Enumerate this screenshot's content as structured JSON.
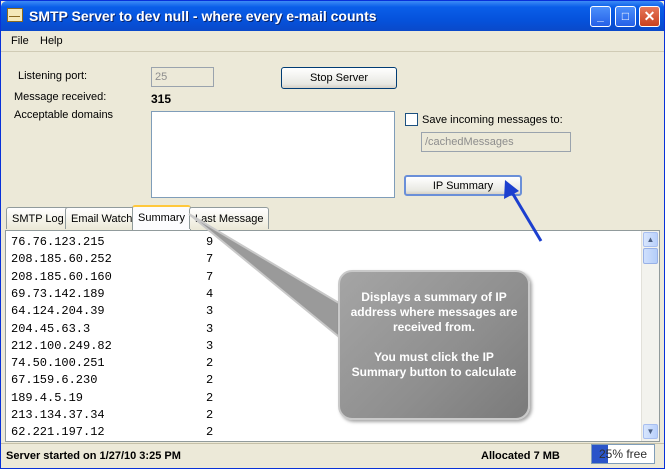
{
  "window": {
    "title": "SMTP Server to dev null - where every e-mail counts"
  },
  "title_buttons": {
    "minimize": "_",
    "maximize": "□",
    "close": "✕"
  },
  "menu": {
    "items": [
      "File",
      "Help"
    ]
  },
  "form": {
    "listening_port_label": "Listening port:",
    "listening_port_value": "25",
    "message_received_label": "Message received:",
    "message_received_value": "315",
    "acceptable_domains_label": "Acceptable domains",
    "stop_server_label": "Stop Server",
    "save_messages_label": "Save incoming messages to:",
    "save_path_value": "/cachedMessages",
    "ip_summary_label": "IP Summary"
  },
  "tabs": [
    "SMTP Log",
    "Email Watch",
    "Summary",
    "Last Message"
  ],
  "active_tab": "Summary",
  "summary_rows": [
    {
      "ip": "76.76.123.215",
      "count": "9"
    },
    {
      "ip": "208.185.60.252",
      "count": "7"
    },
    {
      "ip": "208.185.60.160",
      "count": "7"
    },
    {
      "ip": "69.73.142.189",
      "count": "4"
    },
    {
      "ip": "64.124.204.39",
      "count": "3"
    },
    {
      "ip": "204.45.63.3",
      "count": "3"
    },
    {
      "ip": "212.100.249.82",
      "count": "3"
    },
    {
      "ip": "74.50.100.251",
      "count": "2"
    },
    {
      "ip": "67.159.6.230",
      "count": "2"
    },
    {
      "ip": "189.4.5.19",
      "count": "2"
    },
    {
      "ip": "213.134.37.34",
      "count": "2"
    },
    {
      "ip": "62.221.197.12",
      "count": "2"
    }
  ],
  "status": {
    "started": "Server started on 1/27/10 3:25 PM",
    "allocated": "Allocated 7 MB",
    "memory_free_text": "25% free",
    "memory_free_fraction": 0.25
  },
  "callout": {
    "line1": "Displays a summary of IP address where messages are received from.",
    "line2": "You must click the IP Summary button to calculate"
  },
  "colors": {
    "titlebar": "#0553dd",
    "accent_tab": "#ffc83c",
    "arrow": "#1c3fcf",
    "memory_bar": "#2a54c9"
  }
}
